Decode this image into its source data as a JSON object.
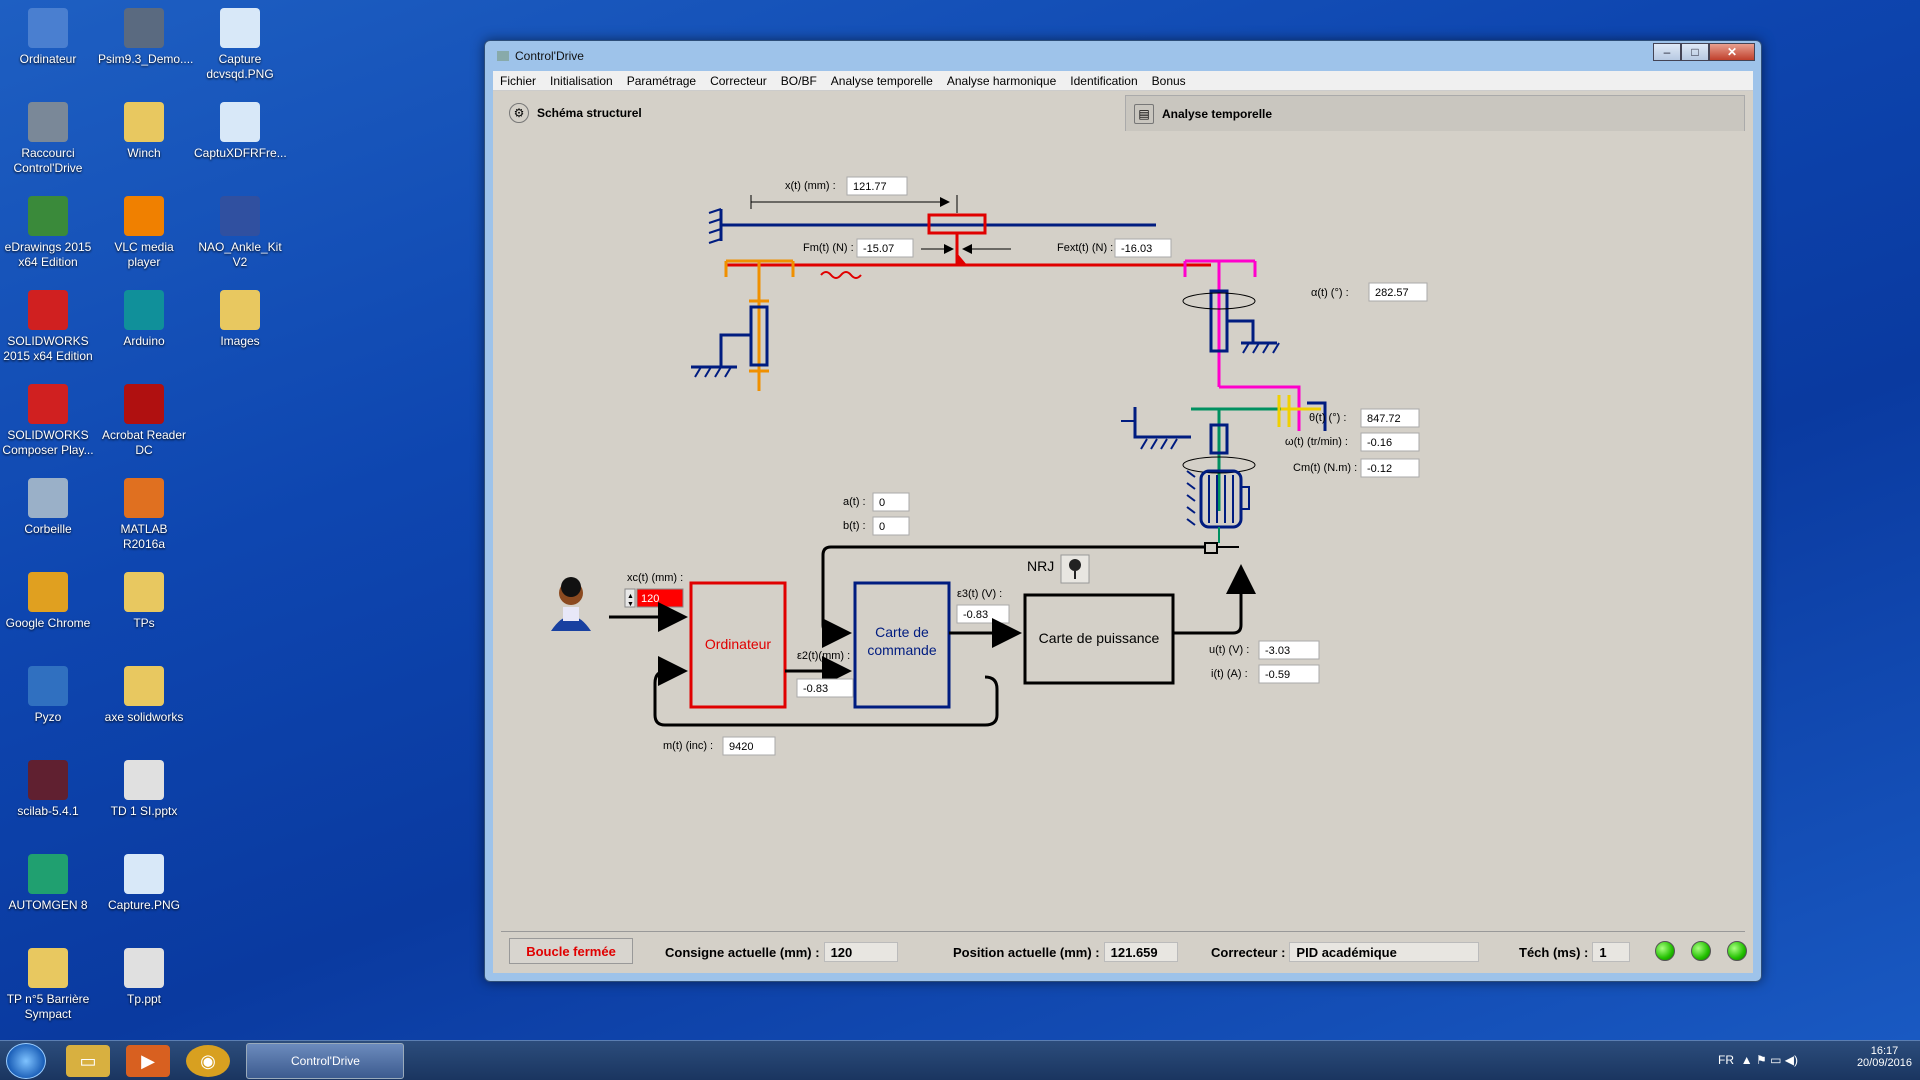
{
  "desktop": {
    "icons": [
      {
        "label": "Ordinateur",
        "icon": "computer-icon",
        "color": "#4a7fd0"
      },
      {
        "label": "Psim9.3_Demo....",
        "icon": "psim-icon",
        "color": "#5a6a80"
      },
      {
        "label": "Capture dcvsqd.PNG",
        "icon": "image-file-icon",
        "color": "#d8e8f8"
      },
      {
        "label": "Raccourci Control'Drive",
        "icon": "shortcut-icon",
        "color": "#7a8898"
      },
      {
        "label": "Winch",
        "icon": "folder-icon",
        "color": "#e8c860"
      },
      {
        "label": "CaptuXDFRFre...",
        "icon": "image-file-icon",
        "color": "#d8e8f8"
      },
      {
        "label": "eDrawings 2015 x64 Edition",
        "icon": "edrawings-icon",
        "color": "#3a8a3a"
      },
      {
        "label": "VLC media player",
        "icon": "vlc-icon",
        "color": "#f08000"
      },
      {
        "label": "NAO_Ankle_Kit V2",
        "icon": "robot-icon",
        "color": "#3050a0"
      },
      {
        "label": "SOLIDWORKS 2015 x64 Edition",
        "icon": "solidworks-icon",
        "color": "#d02020"
      },
      {
        "label": "Arduino",
        "icon": "arduino-icon",
        "color": "#10909a"
      },
      {
        "label": "Images",
        "icon": "folder-icon",
        "color": "#e8c860"
      },
      {
        "label": "SOLIDWORKS Composer Play...",
        "icon": "solidworks-icon",
        "color": "#d02020"
      },
      {
        "label": "Acrobat Reader DC",
        "icon": "acrobat-icon",
        "color": "#b01010"
      },
      {
        "label": "Corbeille",
        "icon": "recycle-bin-icon",
        "color": "#9ab0c8"
      },
      {
        "label": "MATLAB R2016a",
        "icon": "matlab-icon",
        "color": "#e07020"
      },
      {
        "label": "Google Chrome",
        "icon": "chrome-icon",
        "color": "#e0a020"
      },
      {
        "label": "TPs",
        "icon": "folder-icon",
        "color": "#e8c860"
      },
      {
        "label": "Pyzo",
        "icon": "pyzo-icon",
        "color": "#3070c0"
      },
      {
        "label": "axe solidworks",
        "icon": "folder-icon",
        "color": "#e8c860"
      },
      {
        "label": "scilab-5.4.1",
        "icon": "scilab-icon",
        "color": "#602030"
      },
      {
        "label": "TD 1 SI.pptx",
        "icon": "pptx-icon",
        "color": "#e0e0e0"
      },
      {
        "label": "AUTOMGEN 8",
        "icon": "automgen-icon",
        "color": "#20a070"
      },
      {
        "label": "Capture.PNG",
        "icon": "image-file-icon",
        "color": "#d8e8f8"
      },
      {
        "label": "TP n°5 Barrière Sympact",
        "icon": "pdf-icon",
        "color": "#e8c860"
      },
      {
        "label": "Tp.ppt",
        "icon": "ppt-icon",
        "color": "#e0e0e0"
      }
    ]
  },
  "window": {
    "title": "Control'Drive",
    "menu": [
      "Fichier",
      "Initialisation",
      "Paramétrage",
      "Correcteur",
      "BO/BF",
      "Analyse temporelle",
      "Analyse harmonique",
      "Identification",
      "Bonus"
    ],
    "tabs": [
      {
        "label": "Schéma structurel",
        "icon": "gear-icon",
        "active": true
      },
      {
        "label": "Analyse temporelle",
        "icon": "chart-icon",
        "active": false
      }
    ]
  },
  "schema": {
    "x_label": "x(t) (mm) :",
    "x_value": "121.77",
    "fm_label": "Fm(t) (N) :",
    "fm_value": "-15.07",
    "fext_label": "Fext(t) (N) :",
    "fext_value": "-16.03",
    "alpha_label": "α(t) (°) :",
    "alpha_value": "282.57",
    "theta_label": "θ(t) (°) :",
    "theta_value": "847.72",
    "omega_label": "ω(t) (tr/min) :",
    "omega_value": "-0.16",
    "cm_label": "Cm(t) (N.m) :",
    "cm_value": "-0.12",
    "a_label": "a(t) :",
    "a_value": "0",
    "b_label": "b(t) :",
    "b_value": "0",
    "xc_label": "xc(t) (mm) :",
    "xc_value": "120",
    "ordinateur": "Ordinateur",
    "carte_commande_1": "Carte de",
    "carte_commande_2": "commande",
    "carte_puissance": "Carte de puissance",
    "nrj": "NRJ",
    "eps2_label": "ε2(t)(mm) :",
    "eps2_value": "-0.83",
    "eps3_label": "ε3(t) (V) :",
    "eps3_value": "-0.83",
    "u_label": "u(t) (V) :",
    "u_value": "-3.03",
    "i_label": "i(t) (A) :",
    "i_value": "-0.59",
    "m_label": "m(t) (inc) :",
    "m_value": "9420"
  },
  "status": {
    "mode": "Boucle fermée",
    "consigne_label": "Consigne actuelle (mm) :",
    "consigne_value": "120",
    "position_label": "Position actuelle (mm) :",
    "position_value": "121.659",
    "correcteur_label": "Correcteur :",
    "correcteur_value": "PID académique",
    "tech_label": "Téch (ms) :",
    "tech_value": "1"
  },
  "taskbar": {
    "task_label": "Control'Drive",
    "lang": "FR",
    "time": "16:17",
    "date": "20/09/2016"
  }
}
